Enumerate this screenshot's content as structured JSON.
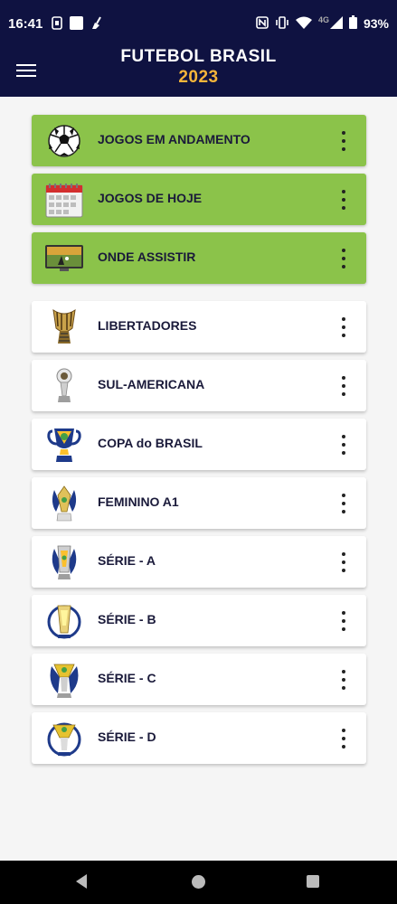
{
  "status_bar": {
    "time": "16:41",
    "battery": "93%",
    "network": "4G",
    "left_icons": [
      "sim-icon",
      "notification-square-icon",
      "broom-icon"
    ],
    "right_icons": [
      "nfc-icon",
      "vibrate-icon",
      "wifi-icon",
      "signal-icon",
      "battery-icon"
    ]
  },
  "app_bar": {
    "title_line1": "FUTEBOL BRASIL",
    "title_line2": "2023",
    "title_color": "#ffffff",
    "year_color": "#f5b53a",
    "background": "#0f1241"
  },
  "menu": {
    "group_top": [
      {
        "label": "JOGOS EM ANDAMENTO",
        "icon": "soccer-ball-icon"
      },
      {
        "label": "JOGOS DE HOJE",
        "icon": "calendar-icon"
      },
      {
        "label": "ONDE ASSISTIR",
        "icon": "tv-icon"
      }
    ],
    "competitions": [
      {
        "label": "LIBERTADORES",
        "icon": "libertadores-trophy-icon"
      },
      {
        "label": "SUL-AMERICANA",
        "icon": "sudamericana-trophy-icon"
      },
      {
        "label": "COPA do BRASIL",
        "icon": "copa-do-brasil-trophy-icon"
      },
      {
        "label": "FEMININO A1",
        "icon": "feminino-trophy-icon"
      },
      {
        "label": "SÉRIE - A",
        "icon": "serie-a-trophy-icon"
      },
      {
        "label": "SÉRIE - B",
        "icon": "serie-b-trophy-icon"
      },
      {
        "label": "SÉRIE - C",
        "icon": "serie-c-trophy-icon"
      },
      {
        "label": "SÉRIE - D",
        "icon": "serie-d-trophy-icon"
      }
    ],
    "highlight_color": "#8bc34a"
  },
  "nav_bar": {
    "icons": [
      "back-icon",
      "home-icon",
      "recents-icon"
    ]
  }
}
